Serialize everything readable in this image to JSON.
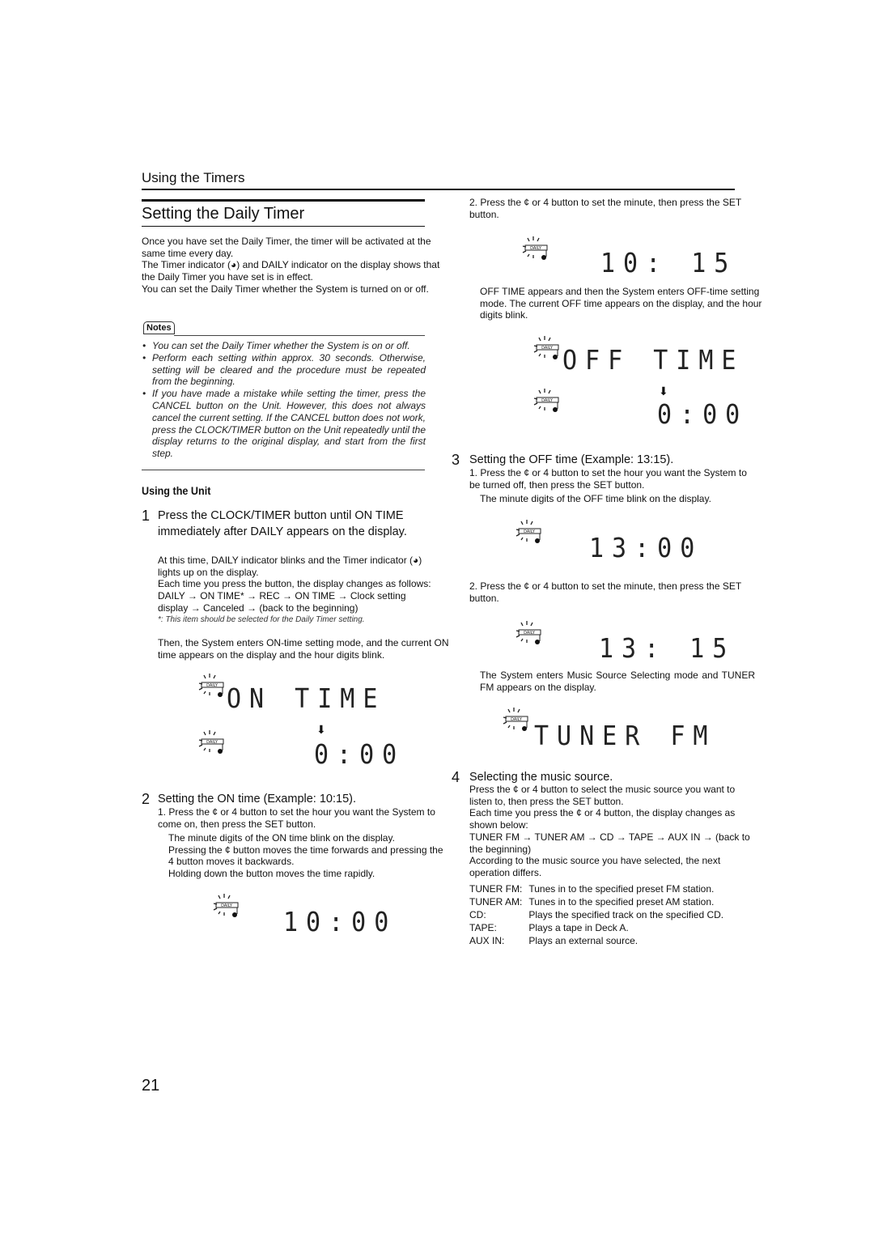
{
  "section_header": "Using the Timers",
  "title": "Setting the Daily Timer",
  "intro": [
    "Once you have set the Daily Timer, the timer will be activated at the same time every day.",
    "The Timer indicator (◕) and DAILY indicator on the display shows that the Daily Timer you have set is in effect.",
    "You can set the Daily Timer whether the System is turned on or off."
  ],
  "notes": {
    "label": "Notes",
    "items": [
      "You can set the Daily Timer whether the System is on or off.",
      "Perform each setting within approx. 30 seconds. Otherwise, setting will be cleared and the procedure must be repeated from the beginning.",
      "If you have made a mistake while setting the timer, press the CANCEL button on the Unit. However, this does not always cancel the current setting. If the CANCEL button does not work, press the CLOCK/TIMER button on the Unit repeatedly until the display returns to the original display, and start from the first step."
    ]
  },
  "using_unit_heading": "Using the Unit",
  "steps": [
    {
      "number": "1",
      "heading": "Press the CLOCK/TIMER button until ON TIME immediately after DAILY appears on the display.",
      "body": [
        "At this time, DAILY indicator blinks and the Timer indicator (◕) lights up on the display.",
        "Each time you press the button, the display changes as follows:",
        "DAILY → ON TIME* → REC → ON TIME → Clock setting display → Canceled → (back to the beginning)"
      ],
      "footnote": "*: This item should be selected for the Daily Timer setting.",
      "after": "Then, the System enters ON-time setting mode, and the current ON time appears on the display and the hour digits blink.",
      "displays": [
        "ON TIME",
        "0:00"
      ]
    },
    {
      "number": "2",
      "heading": "Setting the ON time (Example: 10:15).",
      "sub1": "1. Press the ¢ or 4 button to set the hour you want the System to come on, then press the SET button.",
      "sub1_lines": [
        "The minute digits of the ON time blink on the display.",
        "Pressing the ¢ button moves the time forwards and pressing the 4 button moves it backwards.",
        "Holding down the button moves the time rapidly."
      ],
      "display1": "10:00",
      "sub2": "2. Press the ¢ or 4 button to set the minute, then press the SET button.",
      "display2": "10: 15",
      "after": "OFF TIME appears and then the System enters OFF-time setting mode. The current OFF time appears on the display, and the hour digits blink.",
      "displays_after": [
        "OFF TIME",
        "0:00"
      ]
    },
    {
      "number": "3",
      "heading": "Setting the OFF time (Example: 13:15).",
      "sub1": "1. Press the ¢ or 4 button to set the hour you want the System to be turned off, then press the SET button.",
      "sub1_lines": [
        "The minute digits of the OFF time blink on the display."
      ],
      "display1": "13:00",
      "sub2": "2. Press the ¢ or 4 button to set the minute, then press the SET button.",
      "display2": "13: 15",
      "after": "The System enters Music Source Selecting mode and TUNER FM appears on the display.",
      "display_after": "TUNER FM"
    },
    {
      "number": "4",
      "heading": "Selecting the music source.",
      "body": [
        "Press the ¢ or 4 button to select the music source you want to listen to, then press the SET button.",
        "Each time you press the ¢ or 4 button, the display changes as shown below:",
        "TUNER FM → TUNER AM → CD → TAPE → AUX IN → (back to the beginning)",
        "According to the music source you have selected, the next operation differs."
      ],
      "sources": [
        {
          "name": "TUNER FM:",
          "desc": "Tunes in to the specified preset FM station."
        },
        {
          "name": "TUNER AM:",
          "desc": "Tunes in to the specified preset AM station."
        },
        {
          "name": "CD:",
          "desc": "Plays the specified track on the specified CD."
        },
        {
          "name": "TAPE:",
          "desc": "Plays a tape in Deck A."
        },
        {
          "name": "AUX IN:",
          "desc": "Plays an external source."
        }
      ]
    }
  ],
  "daily_label": "DAILY",
  "page_number": "21"
}
